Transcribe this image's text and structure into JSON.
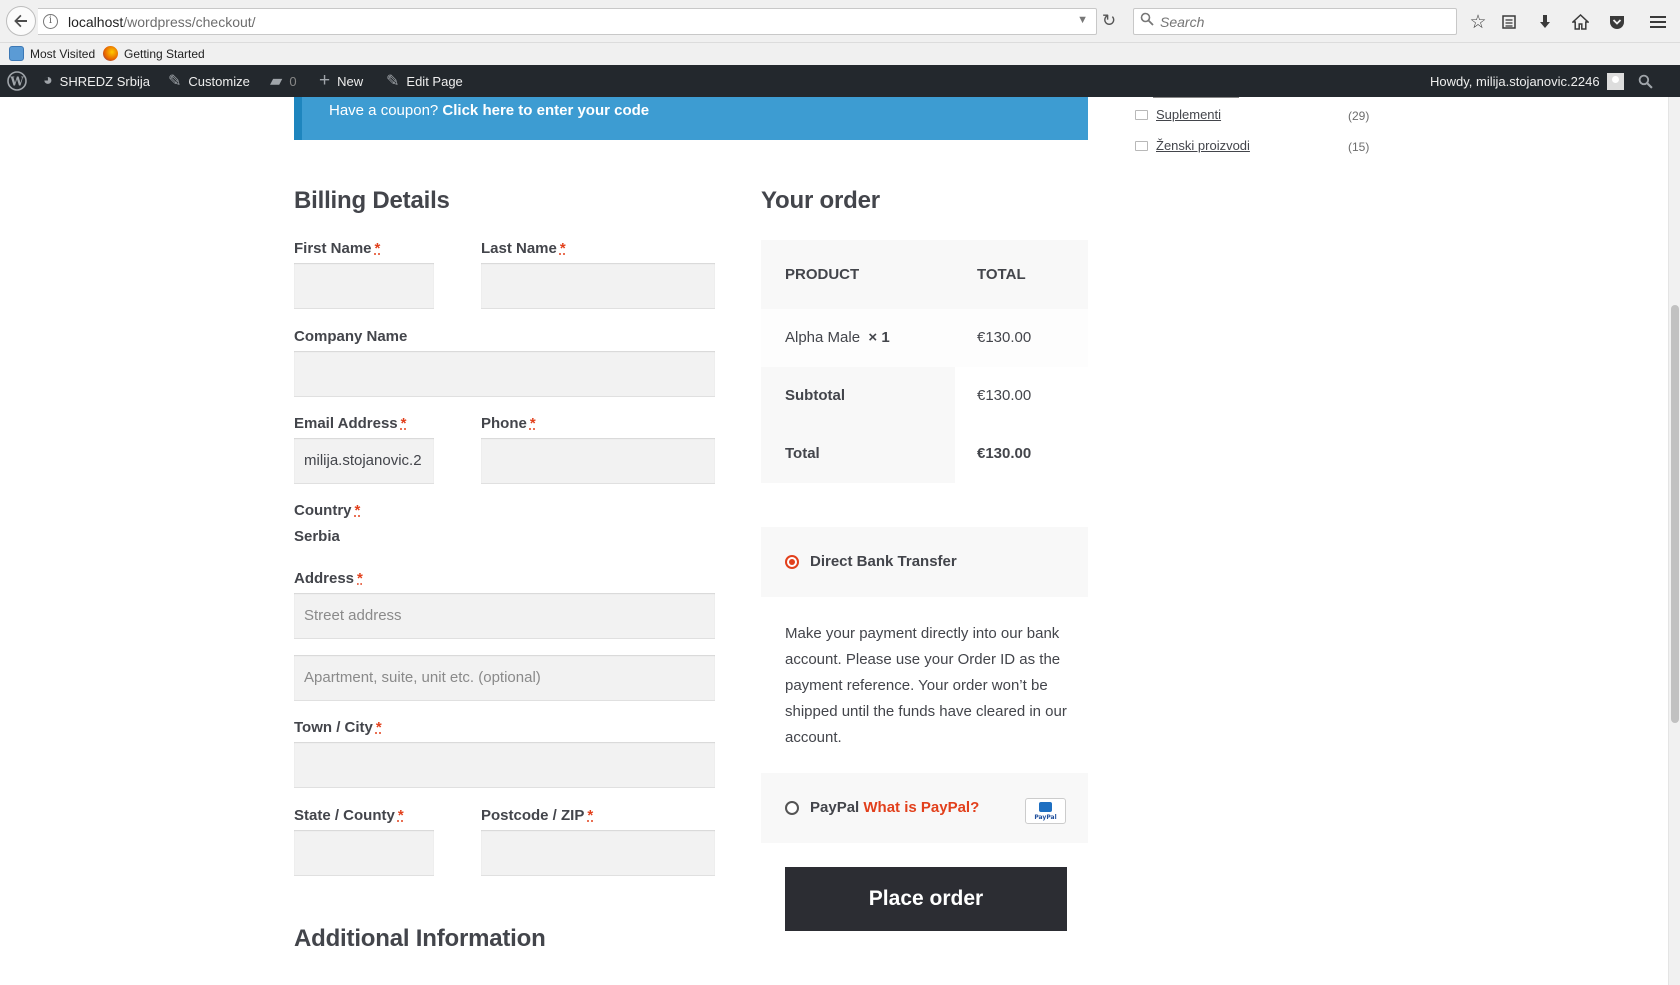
{
  "browser": {
    "url_host": "localhost",
    "url_path": "/wordpress/checkout/",
    "search_placeholder": "Search"
  },
  "bookmarks": [
    "Most Visited",
    "Getting Started"
  ],
  "admin_bar": {
    "site_name": "SHREDZ Srbija",
    "customize": "Customize",
    "comments_count": "0",
    "new": "New",
    "edit_page": "Edit Page",
    "howdy": "Howdy, milija.stojanovic.2246"
  },
  "coupon": {
    "prefix": "Have a coupon?",
    "link": "Click here to enter your code",
    "color": "#3d9cd2"
  },
  "billing": {
    "title": "Billing Details",
    "required_mark": "*",
    "first_name_label": "First Name",
    "last_name_label": "Last Name",
    "company_label": "Company Name",
    "email_label": "Email Address",
    "email_value": "milija.stojanovic.2",
    "phone_label": "Phone",
    "country_label": "Country",
    "country_value": "Serbia",
    "address_label": "Address",
    "street_placeholder": "Street address",
    "apartment_placeholder": "Apartment, suite, unit etc. (optional)",
    "city_label": "Town / City",
    "state_label": "State / County",
    "postcode_label": "Postcode / ZIP",
    "additional_title": "Additional Information"
  },
  "order": {
    "title": "Your order",
    "col_product": "PRODUCT",
    "col_total": "TOTAL",
    "item_name": "Alpha Male",
    "item_qty": "× 1",
    "item_total": "€130.00",
    "subtotal_label": "Subtotal",
    "subtotal_value": "€130.00",
    "total_label": "Total",
    "total_value": "€130.00"
  },
  "payment": {
    "bank_label": "Direct Bank Transfer",
    "bank_description": "Make your payment directly into our bank account. Please use your Order ID as the payment reference. Your order won’t be shipped until the funds have cleared in our account.",
    "paypal_label": "PayPal",
    "paypal_link": "What is PayPal?",
    "paypal_logo_text": "PayPal",
    "place_order": "Place order",
    "accent_color": "#e2401c"
  },
  "sidebar": {
    "categories": [
      {
        "name": "Suplementi",
        "count": "(29)"
      },
      {
        "name": "Ženski proizvodi",
        "count": "(15)"
      }
    ]
  }
}
